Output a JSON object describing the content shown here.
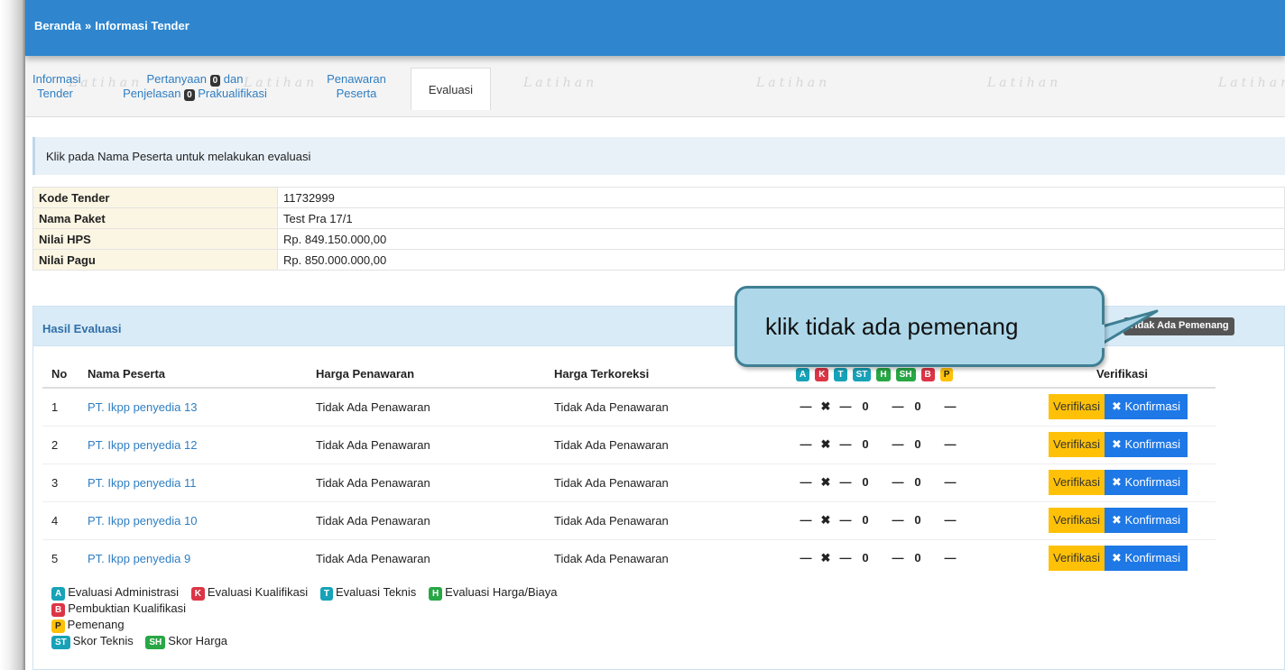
{
  "breadcrumb": {
    "home": "Beranda",
    "separator": "»",
    "current": "Informasi Tender"
  },
  "tabs": {
    "informasi_line1": "Informasi",
    "informasi_line2": "Tender",
    "pertanyaan_line1": "Pertanyaan",
    "pertanyaan_badge": "0",
    "pertanyaan_and": "dan",
    "penjelasan": "Penjelasan",
    "penjelasan_badge": "0",
    "prakualifikasi": "Prakualifikasi",
    "penawaran_line1": "Penawaran",
    "penawaran_line2": "Peserta",
    "evaluasi": "Evaluasi",
    "watermark": "Latihan"
  },
  "alert": "Klik pada Nama Peserta untuk melakukan evaluasi",
  "detail": [
    {
      "key": "Kode Tender",
      "value": "11732999"
    },
    {
      "key": "Nama Paket",
      "value": "Test Pra 17/1"
    },
    {
      "key": "Nilai HPS",
      "value": "Rp. 849.150.000,00"
    },
    {
      "key": "Nilai Pagu",
      "value": "Rp. 850.000.000,00"
    }
  ],
  "panel": {
    "title": "Hasil Evaluasi",
    "no_winner_button": "Tidak Ada Pemenang"
  },
  "callout": "klik tidak ada pemenang",
  "table": {
    "headers": {
      "no": "No",
      "nama": "Nama Peserta",
      "harga": "Harga Penawaran",
      "terkoreksi": "Harga Terkoreksi",
      "verifikasi": "Verifikasi"
    },
    "badges": [
      "A",
      "K",
      "T",
      "ST",
      "H",
      "SH",
      "B",
      "P"
    ],
    "rows": [
      {
        "no": "1",
        "nama": "PT. Ikpp penyedia 13",
        "harga": "Tidak Ada Penawaran",
        "terkoreksi": "Tidak Ada Penawaran",
        "a": "—",
        "k": "✖",
        "t": "—",
        "st": "0",
        "h": "—",
        "sh": "0",
        "b": "—"
      },
      {
        "no": "2",
        "nama": "PT. Ikpp penyedia 12",
        "harga": "Tidak Ada Penawaran",
        "terkoreksi": "Tidak Ada Penawaran",
        "a": "—",
        "k": "✖",
        "t": "—",
        "st": "0",
        "h": "—",
        "sh": "0",
        "b": "—"
      },
      {
        "no": "3",
        "nama": "PT. Ikpp penyedia 11",
        "harga": "Tidak Ada Penawaran",
        "terkoreksi": "Tidak Ada Penawaran",
        "a": "—",
        "k": "✖",
        "t": "—",
        "st": "0",
        "h": "—",
        "sh": "0",
        "b": "—"
      },
      {
        "no": "4",
        "nama": "PT. Ikpp penyedia 10",
        "harga": "Tidak Ada Penawaran",
        "terkoreksi": "Tidak Ada Penawaran",
        "a": "—",
        "k": "✖",
        "t": "—",
        "st": "0",
        "h": "—",
        "sh": "0",
        "b": "—"
      },
      {
        "no": "5",
        "nama": "PT. Ikpp penyedia 9",
        "harga": "Tidak Ada Penawaran",
        "terkoreksi": "Tidak Ada Penawaran",
        "a": "—",
        "k": "✖",
        "t": "—",
        "st": "0",
        "h": "—",
        "sh": "0",
        "b": "—"
      }
    ],
    "verifikasi_label": "Verifikasi",
    "konfirmasi_label": "Konfirmasi"
  },
  "legend": {
    "A": "Evaluasi Administrasi",
    "K": "Evaluasi Kualifikasi",
    "T": "Evaluasi Teknis",
    "H": "Evaluasi Harga/Biaya",
    "B": "Pembuktian Kualifikasi",
    "P": "Pemenang",
    "ST": "Skor Teknis",
    "SH": "Skor Harga"
  },
  "colors": {
    "topbar": "#2f86cf",
    "link": "#2f7ec2",
    "verify": "#ffc107",
    "confirm": "#1e78e6",
    "callout_fill": "#aed8ea",
    "callout_border": "#3f7f93"
  }
}
